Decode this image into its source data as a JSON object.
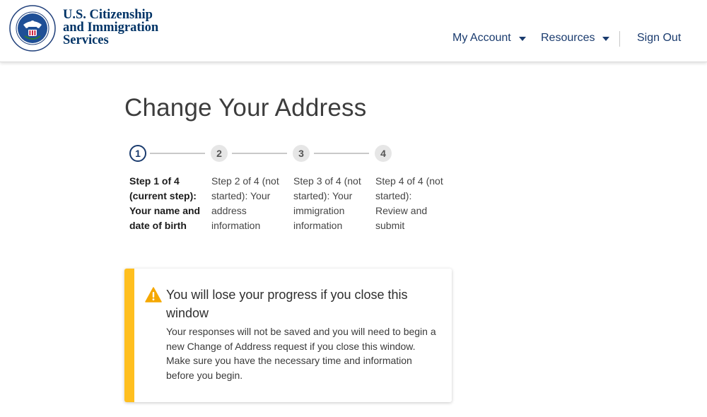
{
  "header": {
    "agency_lines": [
      "U.S. Citizenship",
      "and Immigration",
      "Services"
    ],
    "seal_icon": "dhs-seal-icon",
    "nav": {
      "my_account": "My Account",
      "resources": "Resources",
      "sign_out": "Sign Out"
    }
  },
  "page": {
    "title": "Change Your Address"
  },
  "stepper": {
    "steps": [
      {
        "number": "1",
        "status": "current",
        "label": "Step 1 of 4 (current step): Your name and date of birth"
      },
      {
        "number": "2",
        "status": "not started",
        "label": "Step 2 of 4 (not started): Your address information"
      },
      {
        "number": "3",
        "status": "not started",
        "label": "Step 3 of 4 (not started): Your immigration information"
      },
      {
        "number": "4",
        "status": "not started",
        "label": "Step 4 of 4 (not started): Review and submit"
      }
    ]
  },
  "alert": {
    "icon": "warning-icon",
    "title": "You will lose your progress if you close this window",
    "body": "Your responses will not be saved and you will need to begin a new Change of Address request if you close this window. Make sure you have the necessary time and information before you begin."
  },
  "colors": {
    "brand_navy": "#003366",
    "nav_text": "#1a3b6e",
    "alert_accent": "#ffbf1f"
  }
}
